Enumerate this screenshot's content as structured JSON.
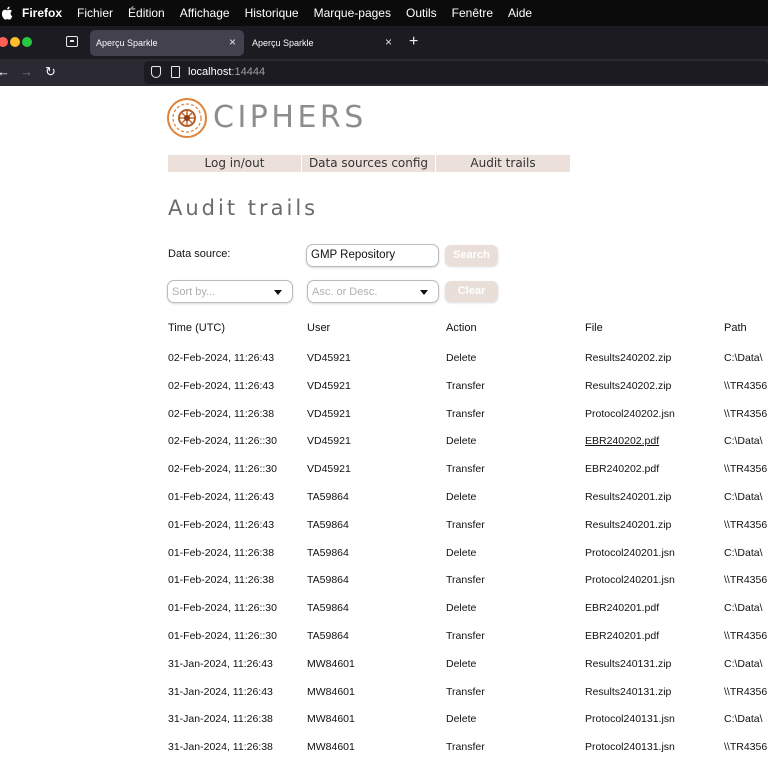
{
  "menubar": {
    "items": [
      "Firefox",
      "Fichier",
      "Édition",
      "Affichage",
      "Historique",
      "Marque-pages",
      "Outils",
      "Fenêtre",
      "Aide"
    ]
  },
  "browser": {
    "tabs": [
      {
        "title": "Aperçu Sparkle"
      },
      {
        "title": "Aperçu Sparkle"
      }
    ],
    "new_tab": "+",
    "tab_close": "×",
    "url_host": "localhost",
    "url_port": ":14444",
    "back": "←",
    "forward": "→",
    "reload": "↻"
  },
  "page": {
    "brand": "CIPHERS",
    "nav": [
      "Log in/out",
      "Data sources config",
      "Audit trails"
    ],
    "title": "Audit trails",
    "data_source_label": "Data source:",
    "data_source_value": "GMP Repository",
    "search_label": "Search",
    "clear_label": "Clear",
    "sort_placeholder": "Sort by...",
    "order_placeholder": "Asc. or Desc."
  },
  "table": {
    "headers": [
      "Time (UTC)",
      "User",
      "Action",
      "File",
      "Path"
    ],
    "rows": [
      [
        "02-Feb-2024, 11:26:43",
        "VD45921",
        "Delete",
        "Results240202.zip",
        "C:\\Data\\"
      ],
      [
        "02-Feb-2024, 11:26:43",
        "VD45921",
        "Transfer",
        "Results240202.zip",
        "\\\\TR4356"
      ],
      [
        "02-Feb-2024, 11:26:38",
        "VD45921",
        "Transfer",
        "Protocol240202.jsn",
        "\\\\TR4356"
      ],
      [
        "02-Feb-2024, 11:26::30",
        "VD45921",
        "Delete",
        "EBR240202.pdf",
        "C:\\Data\\"
      ],
      [
        "02-Feb-2024, 11:26::30",
        "VD45921",
        "Transfer",
        "EBR240202.pdf",
        "\\\\TR4356"
      ],
      [
        "01-Feb-2024, 11:26:43",
        "TA59864",
        "Delete",
        "Results240201.zip",
        "C:\\Data\\"
      ],
      [
        "01-Feb-2024, 11:26:43",
        "TA59864",
        "Transfer",
        "Results240201.zip",
        "\\\\TR4356"
      ],
      [
        "01-Feb-2024, 11:26:38",
        "TA59864",
        "Delete",
        "Protocol240201.jsn",
        "C:\\Data\\"
      ],
      [
        "01-Feb-2024, 11:26:38",
        "TA59864",
        "Transfer",
        "Protocol240201.jsn",
        "\\\\TR4356"
      ],
      [
        "01-Feb-2024, 11:26::30",
        "TA59864",
        "Delete",
        "EBR240201.pdf",
        "C:\\Data\\"
      ],
      [
        "01-Feb-2024, 11:26::30",
        "TA59864",
        "Transfer",
        "EBR240201.pdf",
        "\\\\TR4356"
      ],
      [
        "31-Jan-2024, 11:26:43",
        "MW84601",
        "Delete",
        "Results240131.zip",
        "C:\\Data\\"
      ],
      [
        "31-Jan-2024, 11:26:43",
        "MW84601",
        "Transfer",
        "Results240131.zip",
        "\\\\TR4356"
      ],
      [
        "31-Jan-2024, 11:26:38",
        "MW84601",
        "Delete",
        "Protocol240131.jsn",
        "C:\\Data\\"
      ],
      [
        "31-Jan-2024, 11:26:38",
        "MW84601",
        "Transfer",
        "Protocol240131.jsn",
        "\\\\TR4356"
      ]
    ]
  },
  "colors": {
    "accent": "#e9dfd8",
    "logo_orange": "#e0823a"
  }
}
